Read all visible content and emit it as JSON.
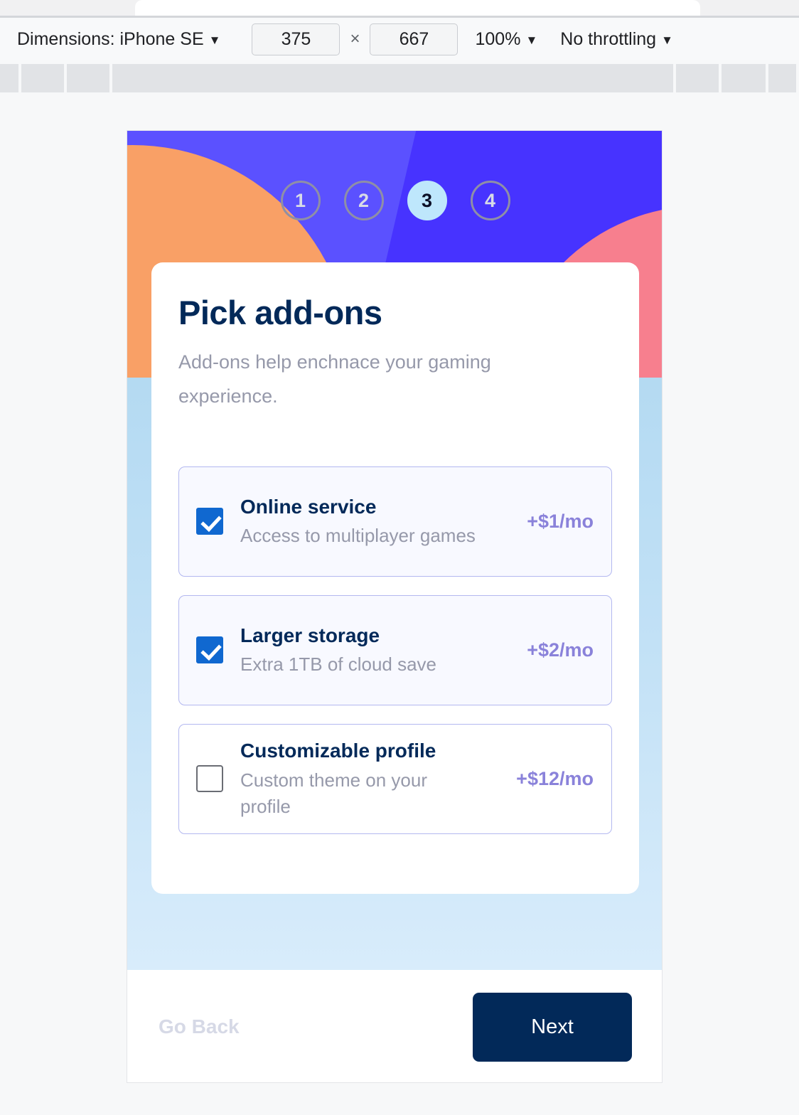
{
  "browser": {
    "tab_strip": {
      "active_tab_label": ""
    }
  },
  "devtools": {
    "device_label": "Dimensions: iPhone SE",
    "device_caret": "▼",
    "width_value": "375",
    "height_value": "667",
    "times_symbol": "×",
    "zoom_label": "100%",
    "zoom_caret": "▼",
    "throttling_label": "No throttling",
    "throttling_caret": "▼"
  },
  "app": {
    "steps": [
      {
        "number": "1",
        "active": false
      },
      {
        "number": "2",
        "active": false
      },
      {
        "number": "3",
        "active": true
      },
      {
        "number": "4",
        "active": false
      }
    ],
    "card": {
      "title": "Pick add-ons",
      "subtitle": "Add-ons help enchnace your gaming experience."
    },
    "addons": [
      {
        "name": "Online service",
        "description": "Access to multiplayer games",
        "price": "+$1/mo",
        "selected": true
      },
      {
        "name": "Larger storage",
        "description": "Extra 1TB of cloud save",
        "price": "+$2/mo",
        "selected": true
      },
      {
        "name": "Customizable profile",
        "description": "Custom theme on your profile",
        "price": "+$12/mo",
        "selected": false
      }
    ],
    "footer": {
      "back_label": "Go Back",
      "next_label": "Next"
    }
  },
  "colors": {
    "hero_blue": "#4733ff",
    "hero_blue_light": "#5b51ff",
    "hero_orange": "#f9a066",
    "hero_pink": "#f77f8e",
    "active_step_bg": "#bee7fc",
    "navy": "#022959",
    "muted_gray": "#9699aa",
    "price_purple": "#8a82da",
    "checkbox_blue": "#1068d0",
    "card_selected_bg": "#f8f9ff",
    "card_border": "#b3b8f0"
  }
}
